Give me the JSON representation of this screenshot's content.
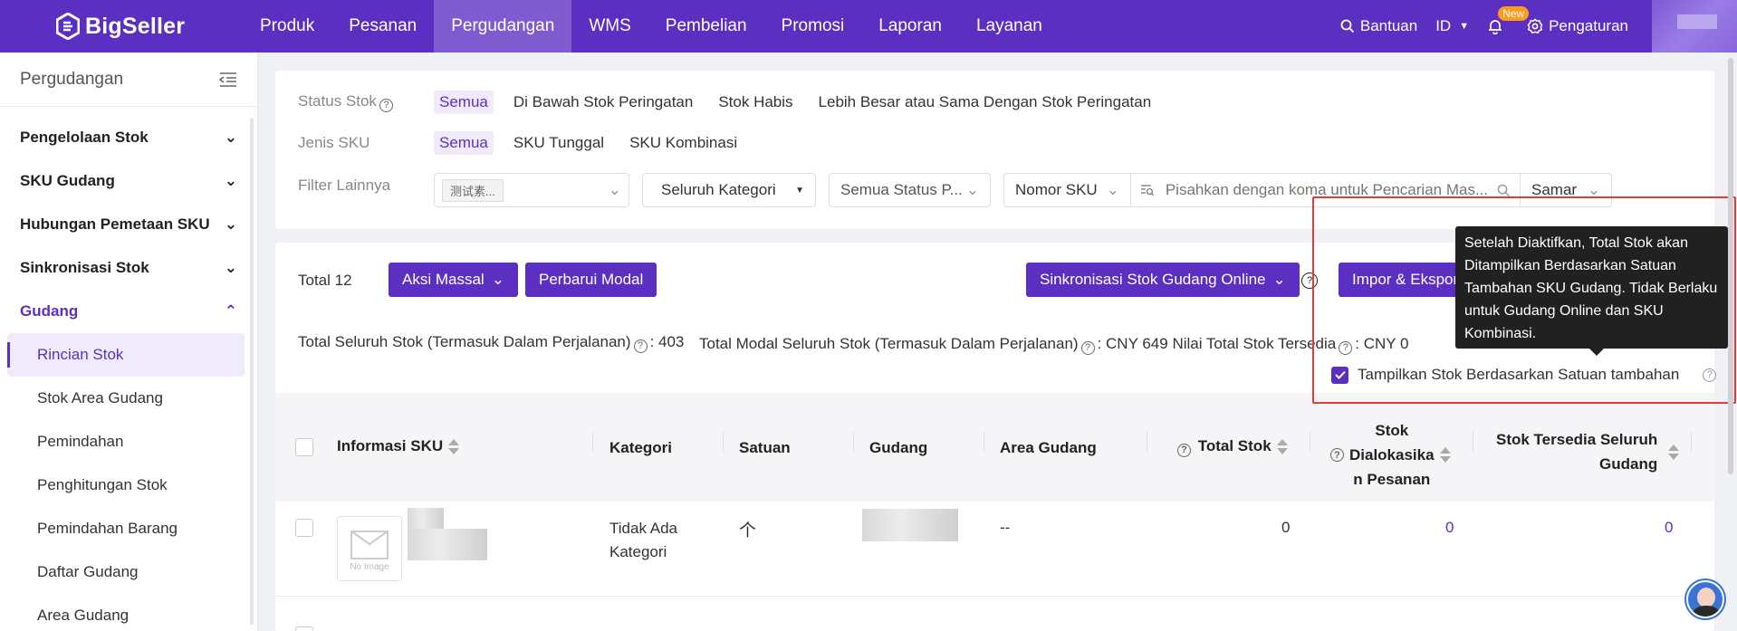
{
  "brand": {
    "name": "BigSeller",
    "accent": "#5a2fc2",
    "highlight": "#e33b32"
  },
  "nav": {
    "items": [
      "Produk",
      "Pesanan",
      "Pergudangan",
      "WMS",
      "Pembelian",
      "Promosi",
      "Laporan",
      "Layanan"
    ],
    "active": "Pergudangan"
  },
  "topright": {
    "help": "Bantuan",
    "lang": "ID",
    "new_badge": "New",
    "settings": "Pengaturan"
  },
  "sidebar": {
    "title": "Pergudangan",
    "groups": [
      "Pengelolaan Stok",
      "SKU Gudang",
      "Hubungan Pemetaan SKU",
      "Sinkronisasi Stok",
      "Gudang"
    ],
    "sub": [
      "Rincian Stok",
      "Stok Area Gudang",
      "Pemindahan",
      "Penghitungan Stok",
      "Pemindahan Barang",
      "Daftar Gudang",
      "Area Gudang"
    ]
  },
  "filters": {
    "status_label": "Status Stok",
    "status_opts": [
      "Semua",
      "Di Bawah Stok Peringatan",
      "Stok Habis",
      "Lebih Besar atau Sama Dengan Stok Peringatan"
    ],
    "type_label": "Jenis SKU",
    "type_opts": [
      "Semua",
      "SKU Tunggal",
      "SKU Kombinasi"
    ],
    "other_label": "Filter Lainnya",
    "warehouse_tag": "测试素...",
    "category": "Seluruh Kategori",
    "status_select": "Semua Status P...",
    "sku_select": "Nomor SKU",
    "search_placeholder": "Pisahkan dengan koma untuk Pencarian Mas...",
    "match": "Samar"
  },
  "toolbar": {
    "total": "Total 12",
    "bulk": "Aksi Massal",
    "update_cost": "Perbarui Modal",
    "sync": "Sinkronisasi Stok Gudang Online",
    "import": "Impor & Ekspor"
  },
  "summary": {
    "total_stock": "Total Seluruh Stok (Termasuk Dalam Perjalanan)",
    "total_stock_value": ": 403",
    "total_cost": "Total Modal Seluruh Stok (Termasuk Dalam Perjalanan)",
    "total_cost_value": ": CNY 649",
    "available": "Nilai Total Stok Tersedia",
    "available_value": ": CNY 0"
  },
  "table": {
    "headers": [
      "Informasi SKU",
      "Kategori",
      "Satuan",
      "Gudang",
      "Area Gudang",
      "Total Stok",
      "Stok Dialokasikan Pesanan",
      "Stok Tersedia Seluruh Gudang"
    ],
    "alloc_lines": [
      "Stok",
      "Dialokasika",
      "n Pesanan"
    ],
    "avail_lines": [
      "Stok Tersedia Seluruh",
      "Gudang"
    ],
    "row1": {
      "img": "No Image",
      "cat": [
        "Tidak Ada",
        "Kategori"
      ],
      "unit": "个",
      "area": "--",
      "total": "0",
      "alloc": "0",
      "avail": "0"
    }
  },
  "tooltip": {
    "text": "Setelah Diaktifkan, Total Stok akan Ditampilkan Berdasarkan Satuan Tambahan SKU Gudang. Tidak Berlaku untuk Gudang Online dan SKU Kombinasi."
  },
  "checkbox": {
    "label": "Tampilkan Stok Berdasarkan Satuan tambahan",
    "checked": true
  }
}
